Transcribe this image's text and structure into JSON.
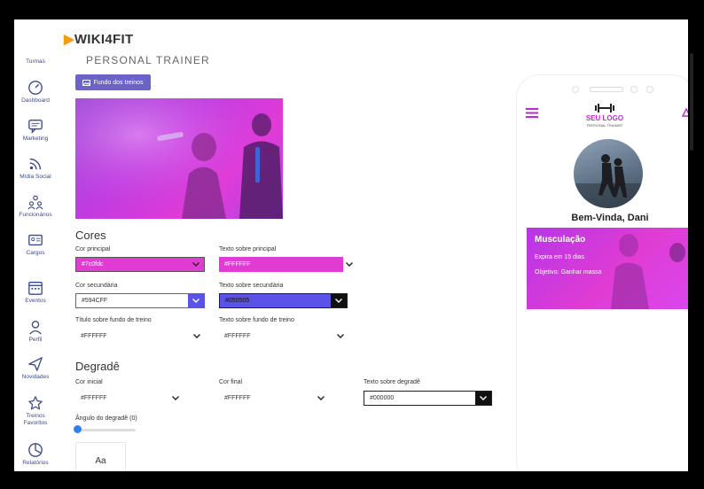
{
  "app": {
    "brand": "WIKI4FIT"
  },
  "sidebar": {
    "items": [
      {
        "label": "Turmas",
        "icon": "users-icon"
      },
      {
        "label": "Dashboard",
        "icon": "gauge-icon"
      },
      {
        "label": "Marketing",
        "icon": "chat-icon"
      },
      {
        "label": "Mídia Social",
        "icon": "rss-icon"
      },
      {
        "label": "Funcionários",
        "icon": "team-icon"
      },
      {
        "label": "Cargos",
        "icon": "badge-icon"
      },
      {
        "label": "Eventos",
        "icon": "calendar-icon"
      },
      {
        "label": "Perfil",
        "icon": "user-icon"
      },
      {
        "label": "Novidades",
        "icon": "send-icon"
      },
      {
        "label_line1": "Treinos",
        "label_line2": "Favoritos",
        "icon": "star-icon"
      },
      {
        "label": "Relatórios",
        "icon": "pie-chart-icon"
      }
    ]
  },
  "page": {
    "title": "PERSONAL TRAINER",
    "bg_button": "Fundo dos treinos"
  },
  "cores": {
    "heading": "Cores",
    "cor_principal": {
      "label": "Cor principal",
      "value": "#7c0fdc",
      "color": "#e03cd3"
    },
    "texto_principal": {
      "label": "Texto sobre principal",
      "value": "#FFFFFF",
      "color": "#e03cd3"
    },
    "cor_secundaria": {
      "label": "Cor secundária",
      "value": "#594CFF",
      "color": "#5b52e8"
    },
    "texto_secundaria": {
      "label": "Texto sobre secundária",
      "value": "#050505",
      "color": "#5b52e8"
    },
    "titulo_fundo": {
      "label": "Título sobre fundo de treino",
      "value": "#FFFFFF"
    },
    "texto_fundo": {
      "label": "Texto sobre fundo de treino",
      "value": "#FFFFFF"
    }
  },
  "degrade": {
    "heading": "Degradê",
    "cor_inicial": {
      "label": "Cor inicial",
      "value": "#FFFFFF"
    },
    "cor_final": {
      "label": "Cor final",
      "value": "#FFFFFF"
    },
    "texto_degrade": {
      "label": "Texto sobre degradê",
      "value": "#000000"
    },
    "angulo_label": "Ângulo do degradê (0)",
    "angulo_value": 0,
    "preview_text": "Aa"
  },
  "phone": {
    "logo_line1": "SEU LOGO",
    "logo_line2": "PERSONAL TRAINER",
    "welcome": "Bem-Vinda, Dani",
    "card_title": "Musculação",
    "card_expire": "Expira em 15 dias",
    "card_goal": "Objetivo: Ganhar massa"
  },
  "colors": {
    "accent": "#6c63c9",
    "sidebar_icon": "#3d4a8a",
    "primary": "#e03cd3",
    "secondary": "#5b52e8"
  }
}
